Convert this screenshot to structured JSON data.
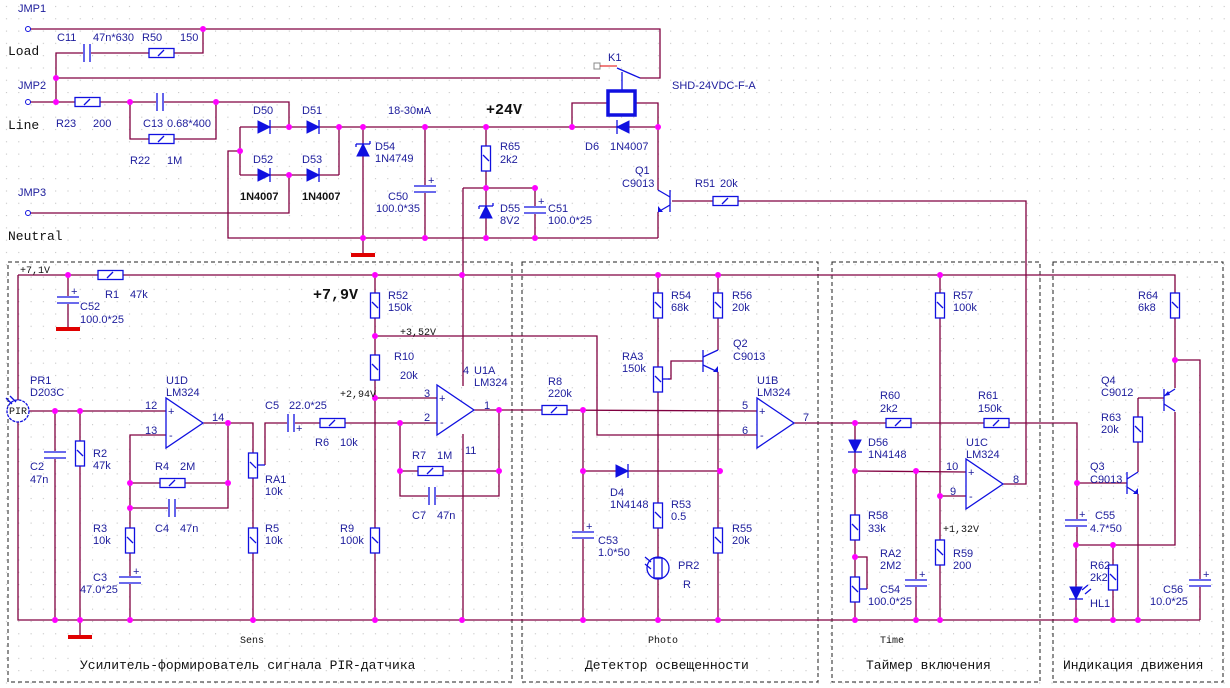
{
  "connectors": {
    "jmp1": "JMP1",
    "jmp2": "JMP2",
    "jmp3": "JMP3",
    "load": "Load",
    "line": "Line",
    "neutral": "Neutral"
  },
  "nets": {
    "v24": "+24V",
    "current": "18-30мА",
    "v79": "+7,9V",
    "v71": "+7,1V",
    "v352": "+3,52V",
    "v294": "+2,94V",
    "v132": "+1,32V"
  },
  "components": {
    "C11": {
      "ref": "C11",
      "value": "47n*630"
    },
    "R50": {
      "ref": "R50",
      "value": "150"
    },
    "R23": {
      "ref": "R23",
      "value": "200"
    },
    "C13": {
      "ref": "C13",
      "value": "0.68*400"
    },
    "R22": {
      "ref": "R22",
      "value": "1M"
    },
    "D50": {
      "ref": "D50"
    },
    "D51": {
      "ref": "D51"
    },
    "D52": {
      "ref": "D52",
      "value": "1N4007"
    },
    "D53": {
      "ref": "D53",
      "value": "1N4007"
    },
    "D54": {
      "ref": "D54",
      "value": "1N4749"
    },
    "C50": {
      "ref": "C50",
      "value": "100.0*35"
    },
    "R65": {
      "ref": "R65",
      "value": "2k2"
    },
    "D55": {
      "ref": "D55",
      "value": "8V2"
    },
    "C51": {
      "ref": "C51",
      "value": "100.0*25"
    },
    "D6": {
      "ref": "D6",
      "value": "1N4007"
    },
    "K1": {
      "ref": "K1",
      "value": "SHD-24VDC-F-A"
    },
    "Q1": {
      "ref": "Q1",
      "value": "C9013"
    },
    "R51": {
      "ref": "R51",
      "value": "20k"
    },
    "R1": {
      "ref": "R1",
      "value": "47k"
    },
    "C52": {
      "ref": "C52",
      "value": "100.0*25"
    },
    "PR1": {
      "ref": "PR1",
      "value": "D203C",
      "symbol": "PIR"
    },
    "C2": {
      "ref": "C2",
      "value": "47n"
    },
    "R2": {
      "ref": "R2",
      "value": "47k"
    },
    "U1D": {
      "ref": "U1D",
      "value": "LM324",
      "pins": [
        "12",
        "13",
        "14"
      ]
    },
    "R4": {
      "ref": "R4",
      "value": "2M"
    },
    "C4": {
      "ref": "C4",
      "value": "47n"
    },
    "R3": {
      "ref": "R3",
      "value": "10k"
    },
    "C3": {
      "ref": "C3",
      "value": "47.0*25"
    },
    "RA1": {
      "ref": "RA1",
      "value": "10k"
    },
    "R5": {
      "ref": "R5",
      "value": "10k"
    },
    "C5": {
      "ref": "C5",
      "value": "22.0*25"
    },
    "R6": {
      "ref": "R6",
      "value": "10k"
    },
    "R52": {
      "ref": "R52",
      "value": "150k"
    },
    "R10": {
      "ref": "R10",
      "value": "20k"
    },
    "R9": {
      "ref": "R9",
      "value": "100k"
    },
    "U1A": {
      "ref": "U1A",
      "value": "LM324",
      "pins": [
        "3",
        "2",
        "1",
        "4",
        "11"
      ]
    },
    "R7": {
      "ref": "R7",
      "value": "1M"
    },
    "C7": {
      "ref": "C7",
      "value": "47n"
    },
    "R8": {
      "ref": "R8",
      "value": "220k"
    },
    "C53": {
      "ref": "C53",
      "value": "1.0*50"
    },
    "D4": {
      "ref": "D4",
      "value": "1N4148"
    },
    "R54": {
      "ref": "R54",
      "value": "68k"
    },
    "RA3": {
      "ref": "RA3",
      "value": "150k"
    },
    "R53": {
      "ref": "R53",
      "value": "0.5"
    },
    "PR2": {
      "ref": "PR2",
      "value": "R"
    },
    "R56": {
      "ref": "R56",
      "value": "20k"
    },
    "Q2": {
      "ref": "Q2",
      "value": "C9013"
    },
    "R55": {
      "ref": "R55",
      "value": "20k"
    },
    "U1B": {
      "ref": "U1B",
      "value": "LM324",
      "pins": [
        "5",
        "6",
        "7"
      ]
    },
    "R60": {
      "ref": "R60",
      "value": "2k2"
    },
    "R61": {
      "ref": "R61",
      "value": "150k"
    },
    "D56": {
      "ref": "D56",
      "value": "1N4148"
    },
    "R58": {
      "ref": "R58",
      "value": "33k"
    },
    "RA2": {
      "ref": "RA2",
      "value": "2M2"
    },
    "C54": {
      "ref": "C54",
      "value": "100.0*25"
    },
    "R57": {
      "ref": "R57",
      "value": "100k"
    },
    "R59": {
      "ref": "R59",
      "value": "200"
    },
    "U1C": {
      "ref": "U1C",
      "value": "LM324",
      "pins": [
        "10",
        "9",
        "8"
      ]
    },
    "R64": {
      "ref": "R64",
      "value": "6k8"
    },
    "Q4": {
      "ref": "Q4",
      "value": "C9012"
    },
    "R63": {
      "ref": "R63",
      "value": "20k"
    },
    "Q3": {
      "ref": "Q3",
      "value": "C9013"
    },
    "C55": {
      "ref": "C55",
      "value": "4.7*50"
    },
    "R62": {
      "ref": "R62",
      "value": "2k2"
    },
    "HL1": {
      "ref": "HL1"
    },
    "C56": {
      "ref": "C56",
      "value": "10.0*25"
    }
  },
  "sections": [
    {
      "title": "Усилитель-формирователь сигнала PIR-датчика",
      "tag": "Sens"
    },
    {
      "title": "Детектор освещенности",
      "tag": "Photo"
    },
    {
      "title": "Таймер включения",
      "tag": "Time"
    },
    {
      "title": "Индикация движения"
    }
  ],
  "colors": {
    "wire": "#800040",
    "component": "#1010e0",
    "junction": "#ff00ff",
    "ground": "#e00000",
    "label": "#1c1c9c"
  }
}
